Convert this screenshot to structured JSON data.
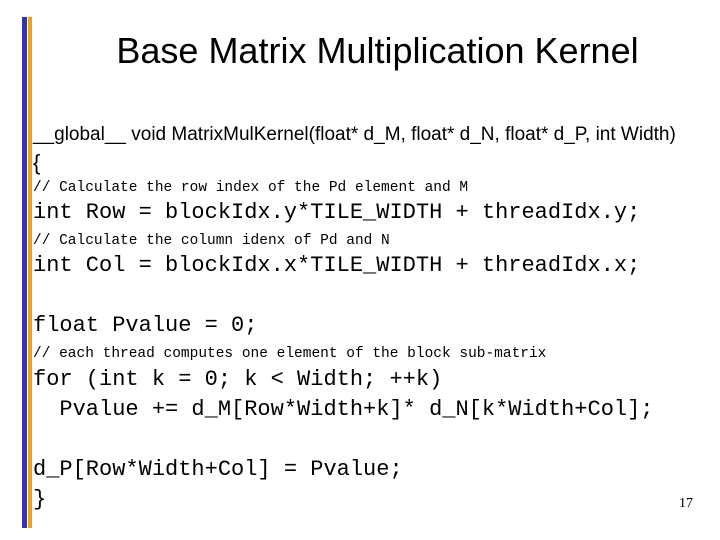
{
  "slide": {
    "title": "Base Matrix Multiplication Kernel",
    "page_number": "17",
    "accent_colors": {
      "left_bar_blue": "#3333aa",
      "left_bar_orange": "#f0a020"
    },
    "code": {
      "signature": "__global__ void MatrixMulKernel(float* d_M, float* d_N, float* d_P, int Width)",
      "open_brace": "{",
      "comment_row": "// Calculate the row index of the Pd element and M",
      "row_stmt": "int Row = blockIdx.y*TILE_WIDTH + threadIdx.y;",
      "comment_col": "// Calculate the column idenx of Pd and N",
      "col_stmt": "int Col = blockIdx.x*TILE_WIDTH + threadIdx.x;",
      "pvalue_init": "float Pvalue = 0;",
      "comment_loop": "// each thread computes one element of the block sub-matrix",
      "for_stmt": "for (int k = 0; k < Width; ++k)",
      "loop_body": "  Pvalue += d_M[Row*Width+k]* d_N[k*Width+Col];",
      "assign_stmt": "d_P[Row*Width+Col] = Pvalue;",
      "close_brace": "}"
    }
  }
}
